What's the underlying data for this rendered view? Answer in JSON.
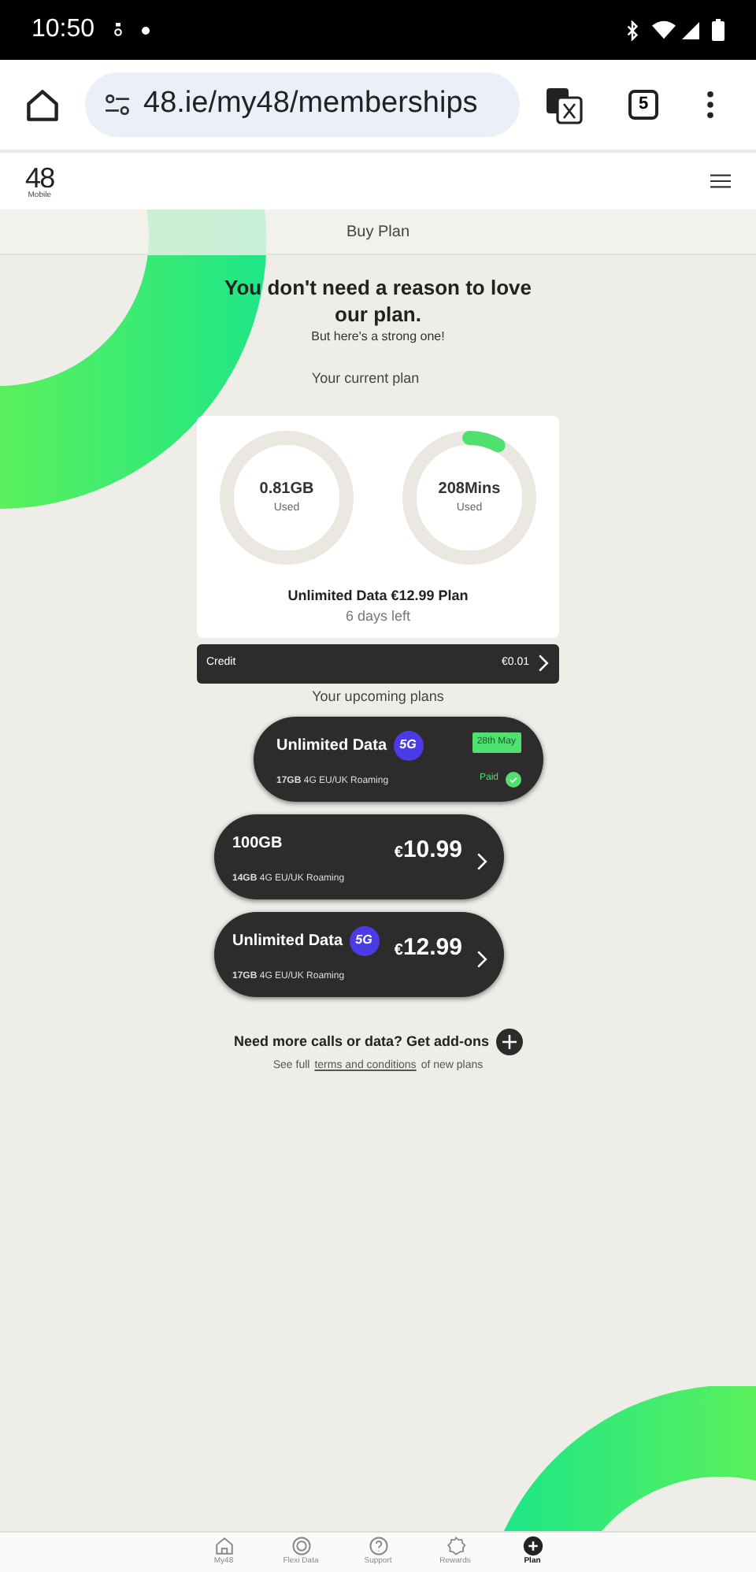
{
  "status_bar": {
    "time": "10:50"
  },
  "browser": {
    "url": "48.ie/my48/memberships",
    "tab_count": "5"
  },
  "site": {
    "logo": "48",
    "logo_sub": "Mobile"
  },
  "page_title": "Buy Plan",
  "hero": {
    "title": "You don't need a reason to love our plan.",
    "subtitle": "But here's a strong one!"
  },
  "current_plan": {
    "heading": "Your current plan",
    "meters": [
      {
        "value": "0.81GB",
        "label": "Used",
        "level": 0
      },
      {
        "value": "208Mins",
        "label": "Used",
        "level": 0.08
      }
    ],
    "plan_name": "Unlimited Data €12.99 Plan",
    "days_left": "6 days left"
  },
  "credit": {
    "label": "Credit",
    "amount": "€0.01"
  },
  "upcoming": {
    "heading": "Your upcoming plans",
    "plans": [
      {
        "kind": "paid",
        "name": "Unlimited Data",
        "badge": "5G",
        "details": "**17GB** 4G EU/UK Roaming",
        "date": "28th May",
        "status": "Paid"
      },
      {
        "kind": "price",
        "name": "100GB",
        "details": "**14GB** 4G EU/UK Roaming",
        "currency": "€",
        "price": "10.99"
      },
      {
        "kind": "price",
        "name": "Unlimited Data",
        "badge": "5G",
        "details": "**17GB** 4G EU/UK Roaming",
        "currency": "€",
        "price": "12.99"
      }
    ]
  },
  "addons": {
    "text": "Need more calls or data? Get add-ons",
    "note_before": "See full",
    "link": "terms and conditions",
    "note_after": "of new plans"
  },
  "bottom_nav": [
    {
      "label": "My48",
      "selected": false
    },
    {
      "label": "Flexi Data",
      "selected": false
    },
    {
      "label": "Support",
      "selected": false
    },
    {
      "label": "Rewards",
      "selected": false
    },
    {
      "label": "Plan",
      "selected": true
    }
  ]
}
